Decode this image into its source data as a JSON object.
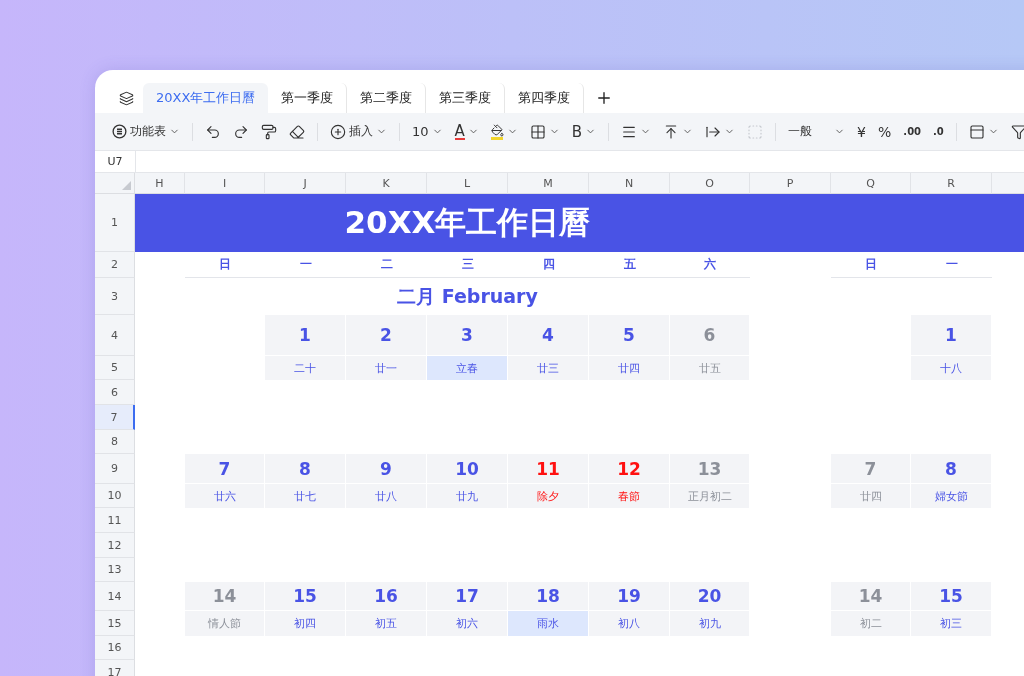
{
  "tabs": [
    {
      "label": "20XX年工作日曆",
      "selected": true
    },
    {
      "label": "第一季度",
      "selected": false
    },
    {
      "label": "第二季度",
      "selected": false
    },
    {
      "label": "第三季度",
      "selected": false
    },
    {
      "label": "第四季度",
      "selected": false
    }
  ],
  "toolbar": {
    "function_menu": "功能表",
    "insert": "插入",
    "font_size": "10",
    "font_color": "A",
    "bold": "B",
    "number_format": "一般",
    "currency": "¥",
    "percent": "%",
    "increase_decimal": ".00",
    "decrease_decimal": ".0",
    "merge_disabled": true
  },
  "name_box": "U7",
  "columns": [
    {
      "label": "H",
      "selected": false
    },
    {
      "label": "I",
      "selected": false
    },
    {
      "label": "J",
      "selected": false
    },
    {
      "label": "K",
      "selected": false
    },
    {
      "label": "L",
      "selected": false
    },
    {
      "label": "M",
      "selected": false
    },
    {
      "label": "N",
      "selected": false
    },
    {
      "label": "O",
      "selected": false
    },
    {
      "label": "P",
      "selected": false
    },
    {
      "label": "Q",
      "selected": false
    },
    {
      "label": "R",
      "selected": false
    }
  ],
  "rows": [
    {
      "label": "1",
      "selected": false
    },
    {
      "label": "2",
      "selected": false
    },
    {
      "label": "3",
      "selected": false
    },
    {
      "label": "4",
      "selected": false
    },
    {
      "label": "5",
      "selected": false
    },
    {
      "label": "6",
      "selected": false
    },
    {
      "label": "7",
      "selected": true
    },
    {
      "label": "8",
      "selected": false
    },
    {
      "label": "9",
      "selected": false
    },
    {
      "label": "10",
      "selected": false
    },
    {
      "label": "11",
      "selected": false
    },
    {
      "label": "12",
      "selected": false
    },
    {
      "label": "13",
      "selected": false
    },
    {
      "label": "14",
      "selected": false
    },
    {
      "label": "15",
      "selected": false
    },
    {
      "label": "16",
      "selected": false
    },
    {
      "label": "17",
      "selected": false
    }
  ],
  "title": "20XX年工作日曆",
  "months": [
    {
      "title": "二月 February",
      "weekdays": [
        "日",
        "一",
        "二",
        "三",
        "四",
        "五",
        "六"
      ],
      "weeks": [
        {
          "days": [
            {
              "kind": "blank"
            },
            {
              "kind": "workday",
              "date": "1",
              "lunar": "二十",
              "highlighted": false
            },
            {
              "kind": "workday",
              "date": "2",
              "lunar": "廿一",
              "highlighted": false
            },
            {
              "kind": "workday",
              "date": "3",
              "lunar": "立春",
              "highlighted": true
            },
            {
              "kind": "workday",
              "date": "4",
              "lunar": "廿三",
              "highlighted": false
            },
            {
              "kind": "workday",
              "date": "5",
              "lunar": "廿四",
              "highlighted": false
            },
            {
              "kind": "weekend",
              "date": "6",
              "lunar": "廿五",
              "highlighted": false
            }
          ]
        },
        {
          "days": [
            {
              "kind": "workday",
              "date": "7",
              "lunar": "廿六",
              "highlighted": false
            },
            {
              "kind": "workday",
              "date": "8",
              "lunar": "廿七",
              "highlighted": false
            },
            {
              "kind": "workday",
              "date": "9",
              "lunar": "廿八",
              "highlighted": false
            },
            {
              "kind": "workday",
              "date": "10",
              "lunar": "廿九",
              "highlighted": false
            },
            {
              "kind": "holiday",
              "date": "11",
              "lunar": "除夕",
              "highlighted": false
            },
            {
              "kind": "holiday",
              "date": "12",
              "lunar": "春節",
              "highlighted": false
            },
            {
              "kind": "weekend",
              "date": "13",
              "lunar": "正月初二",
              "highlighted": false
            }
          ]
        },
        {
          "days": [
            {
              "kind": "weekend",
              "date": "14",
              "lunar": "情人節",
              "highlighted": false
            },
            {
              "kind": "workday",
              "date": "15",
              "lunar": "初四",
              "highlighted": false
            },
            {
              "kind": "workday",
              "date": "16",
              "lunar": "初五",
              "highlighted": false
            },
            {
              "kind": "workday",
              "date": "17",
              "lunar": "初六",
              "highlighted": false
            },
            {
              "kind": "workday",
              "date": "18",
              "lunar": "雨水",
              "highlighted": true
            },
            {
              "kind": "workday",
              "date": "19",
              "lunar": "初八",
              "highlighted": false
            },
            {
              "kind": "workday",
              "date": "20",
              "lunar": "初九",
              "highlighted": false
            }
          ]
        }
      ]
    },
    {
      "weekdays": [
        "日",
        "一"
      ],
      "weeks": [
        {
          "days": [
            {
              "kind": "blank"
            },
            {
              "kind": "workday",
              "date": "1",
              "lunar": "十八",
              "highlighted": false
            }
          ]
        },
        {
          "days": [
            {
              "kind": "weekend",
              "date": "7",
              "lunar": "廿四",
              "highlighted": false
            },
            {
              "kind": "workday",
              "date": "8",
              "lunar": "婦女節",
              "highlighted": false
            }
          ]
        },
        {
          "days": [
            {
              "kind": "weekend",
              "date": "14",
              "lunar": "初二",
              "highlighted": false
            },
            {
              "kind": "workday",
              "date": "15",
              "lunar": "初三",
              "highlighted": false
            }
          ]
        }
      ]
    }
  ]
}
